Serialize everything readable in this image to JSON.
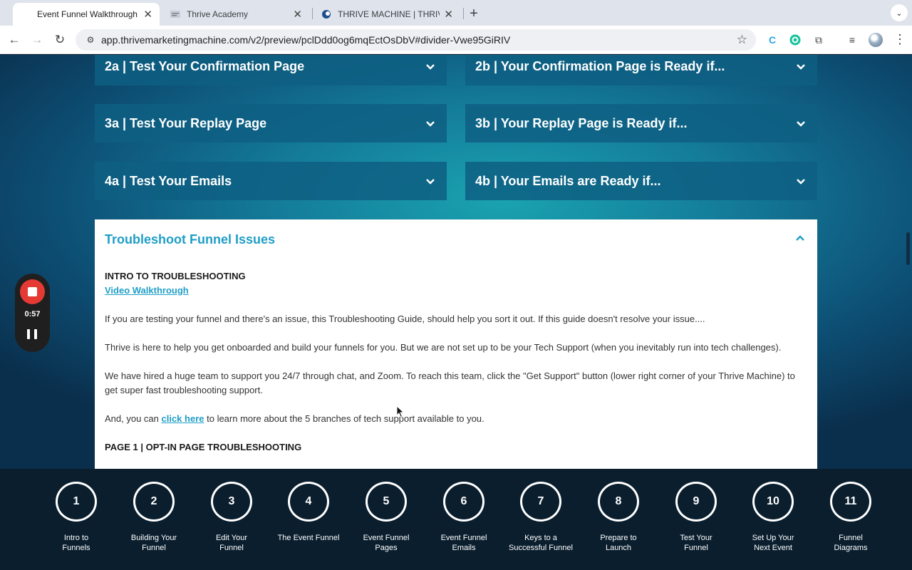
{
  "browser": {
    "tabs": [
      {
        "title": "Event Funnel Walkthrough (S",
        "active": true
      },
      {
        "title": "Thrive Academy",
        "active": false
      },
      {
        "title": "THRIVE MACHINE | THRIVE A",
        "active": false
      }
    ],
    "new_tab_label": "+",
    "url": "app.thrivemarketingmachine.com/v2/preview/pclDdd0og6mqEctOsDbV#divider-Vwe95GiRIV"
  },
  "accordions": [
    {
      "title": "2a | Test Your Confirmation Page"
    },
    {
      "title": "2b | Your Confirmation Page is Ready if..."
    },
    {
      "title": "3a | Test Your Replay Page"
    },
    {
      "title": "3b | Your Replay Page is Ready if..."
    },
    {
      "title": "4a | Test Your Emails"
    },
    {
      "title": "4b | Your Emails are Ready if..."
    }
  ],
  "troubleshoot": {
    "title": "Troubleshoot Funnel Issues",
    "intro_heading": "INTRO TO TROUBLESHOOTING",
    "video_link": "Video Walkthrough",
    "para1": "If you are testing your funnel and there's an issue, this Troubleshooting Guide, should help you sort it out. If this guide doesn't resolve your issue....",
    "para2": "Thrive is here to help you get onboarded and build your funnels for you. But we are not set up to be your Tech Support (when you inevitably run into tech challenges).",
    "para3": "We have hired a huge team to support you 24/7 through chat, and Zoom. To reach this team, click the \"Get Support\" button (lower right corner of your Thrive Machine) to get super fast troubleshooting support.",
    "para4_before": "And, you can ",
    "para4_link": "click here",
    "para4_after": " to learn more about the 5 branches of tech support available to you.",
    "page1_heading": "PAGE 1 | OPT-IN PAGE TROUBLESHOOTING"
  },
  "recorder": {
    "time": "0:57"
  },
  "steps": [
    {
      "number": "1",
      "label": "Intro to\nFunnels"
    },
    {
      "number": "2",
      "label": "Building Your\nFunnel"
    },
    {
      "number": "3",
      "label": "Edit Your\nFunnel"
    },
    {
      "number": "4",
      "label": "The Event Funnel"
    },
    {
      "number": "5",
      "label": "Event Funnel\nPages"
    },
    {
      "number": "6",
      "label": "Event Funnel\nEmails"
    },
    {
      "number": "7",
      "label": "Keys to a\nSuccessful Funnel"
    },
    {
      "number": "8",
      "label": "Prepare to\nLaunch"
    },
    {
      "number": "9",
      "label": "Test Your\nFunnel"
    },
    {
      "number": "10",
      "label": "Set Up Your\nNext Event"
    },
    {
      "number": "11",
      "label": "Funnel\nDiagrams"
    }
  ],
  "colors": {
    "accent": "#1f9ec7",
    "accordion_bg": "#0e5f82",
    "step_bar_bg": "#0a1e2e",
    "record_red": "#e53a34"
  }
}
